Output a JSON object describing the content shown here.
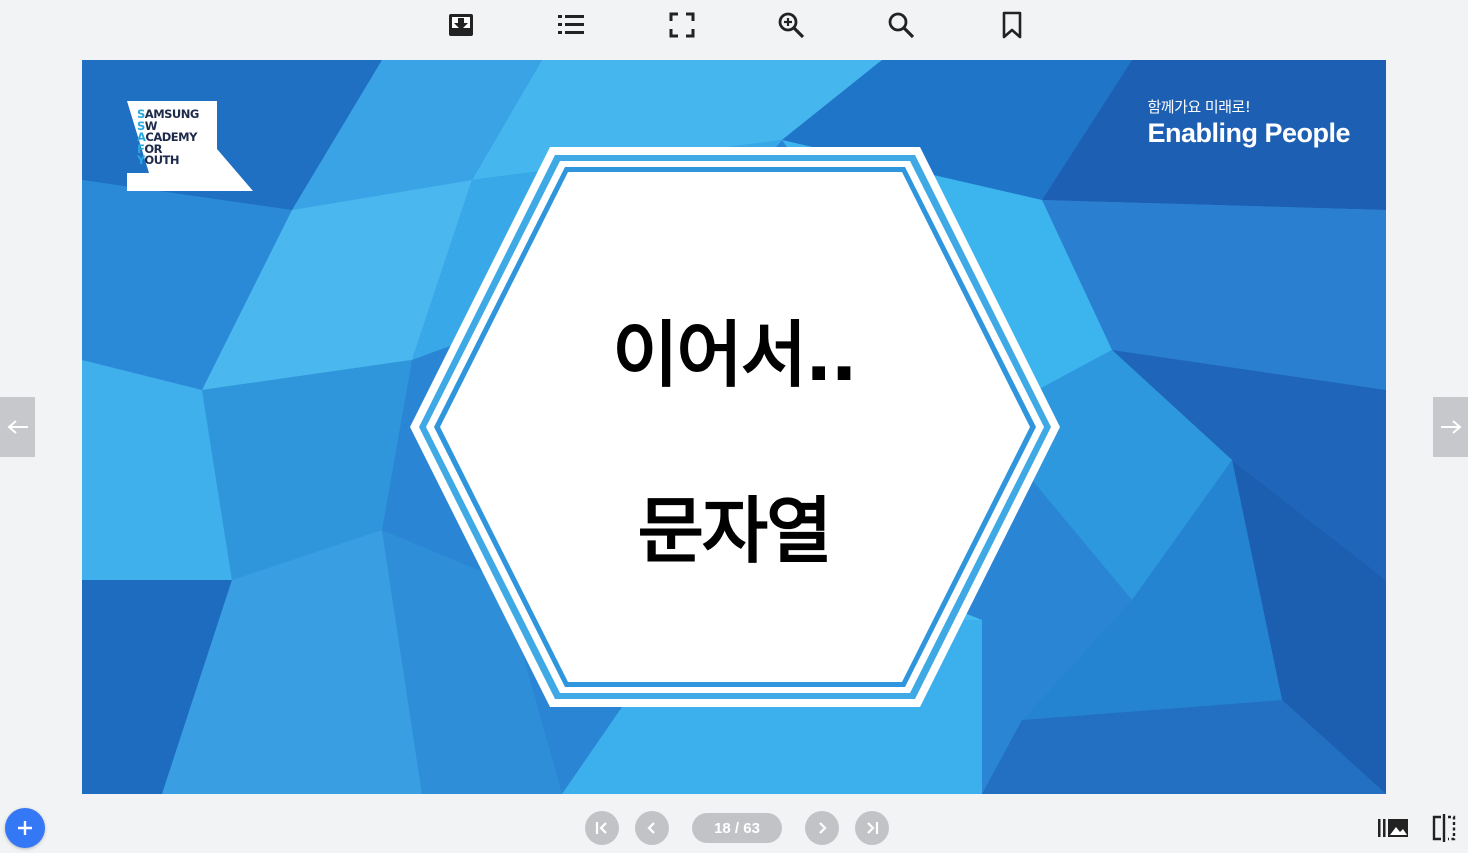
{
  "toolbar": {
    "icons": [
      "download-icon",
      "list-icon",
      "fullscreen-icon",
      "zoom-in-icon",
      "search-icon",
      "bookmark-icon"
    ]
  },
  "slide": {
    "logo": {
      "lines": [
        {
          "initial": "S",
          "rest": "AMSUNG"
        },
        {
          "initial": "S",
          "rest": "W"
        },
        {
          "initial": "A",
          "rest": "CADEMY"
        },
        {
          "initial": "F",
          "rest": "OR"
        },
        {
          "initial": "Y",
          "rest": "OUTH"
        }
      ]
    },
    "tagline_ko": "함께가요 미래로!",
    "tagline_en": "Enabling People",
    "title_line1": "이어서..",
    "title_line2": "문자열"
  },
  "navigation": {
    "page_indicator": "18 / 63"
  },
  "colors": {
    "background": "#f2f3f5",
    "slide_blue": "#2a86d4",
    "fab": "#3478f6",
    "nav_button": "#c2c3c6"
  }
}
